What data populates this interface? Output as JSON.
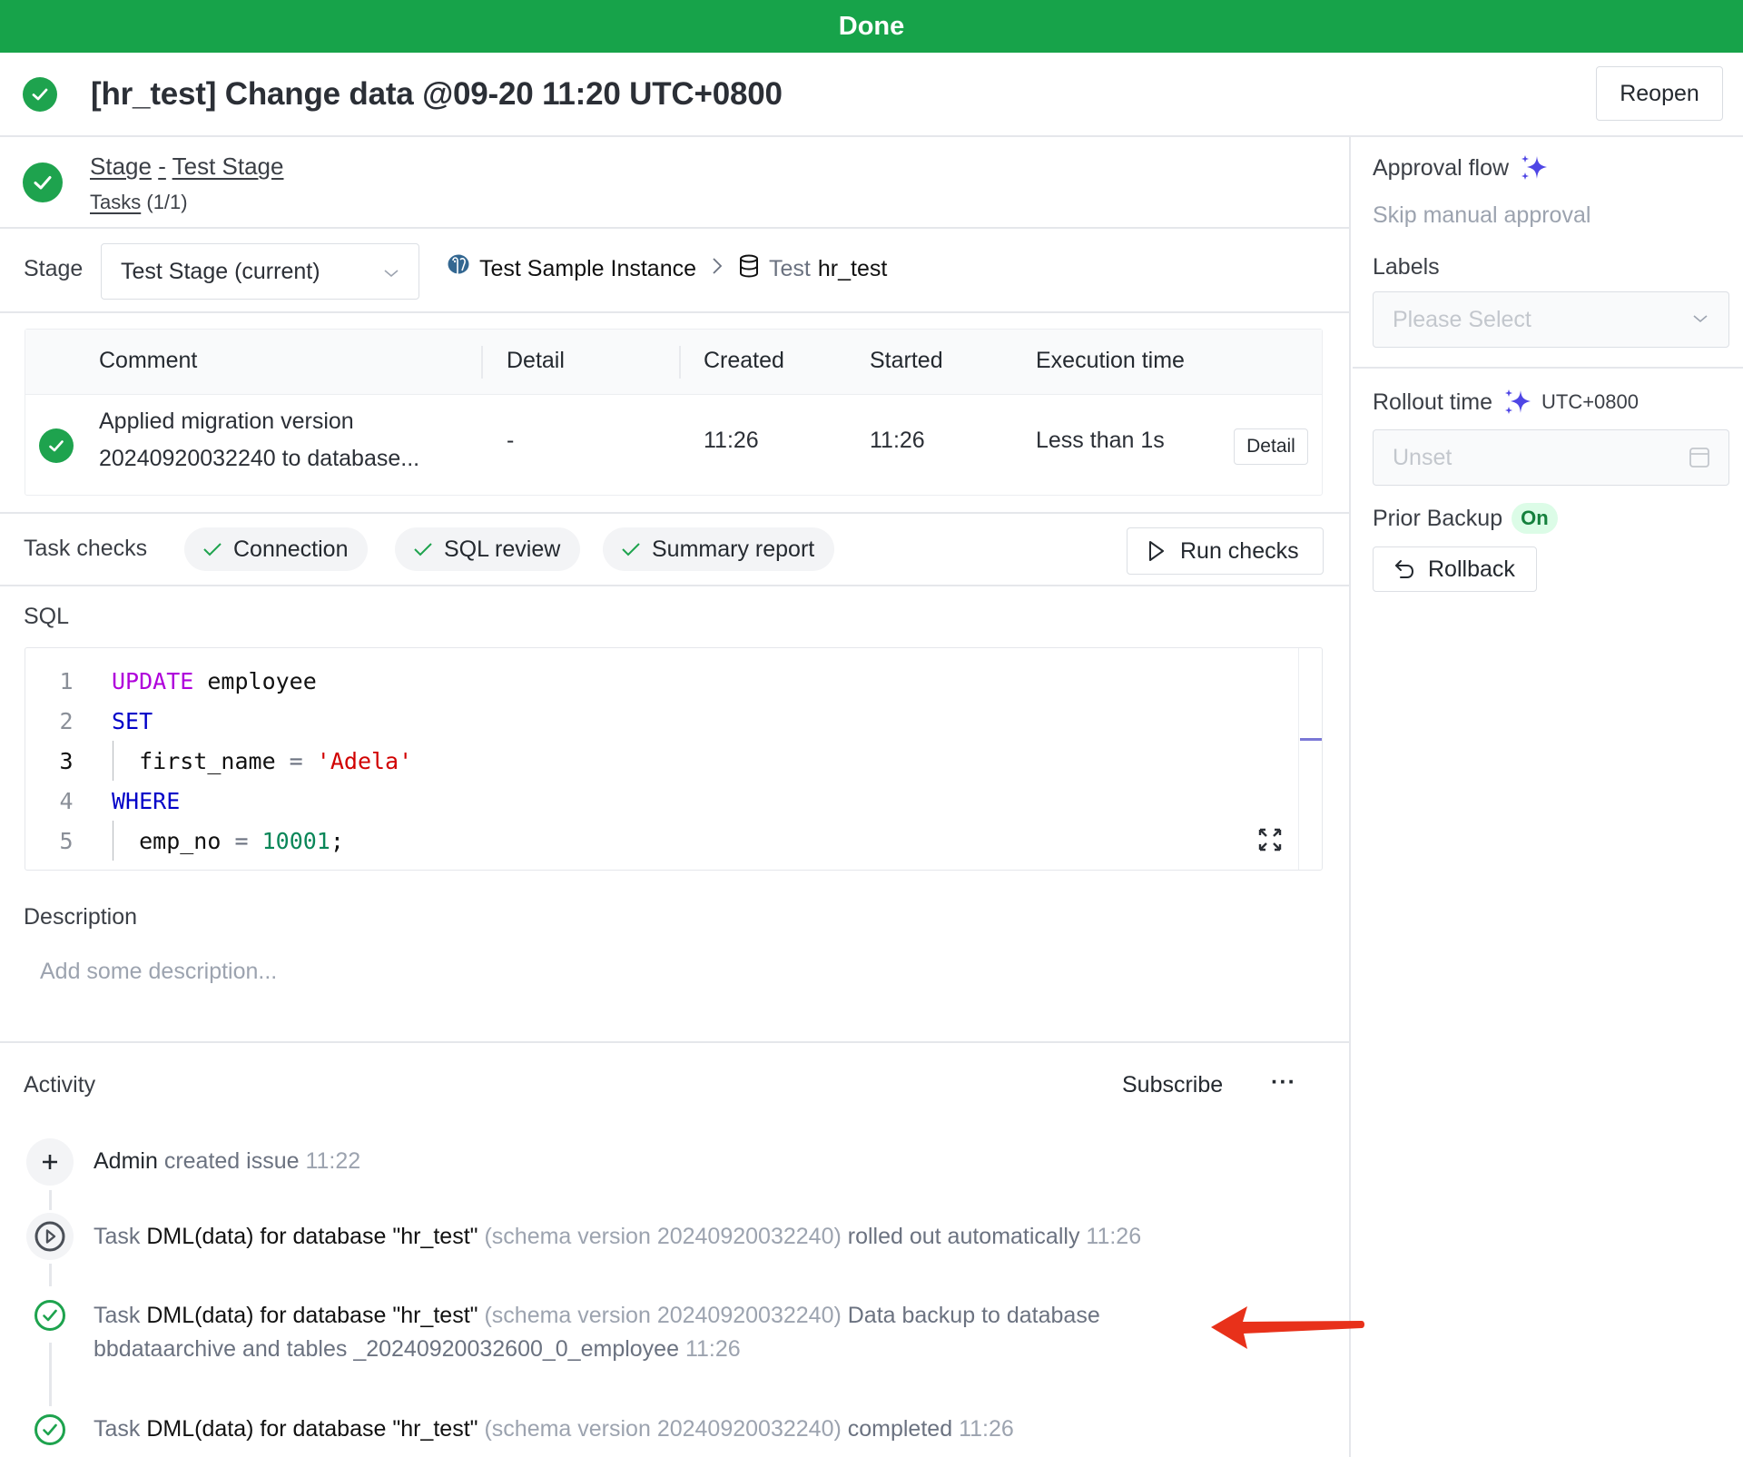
{
  "status_bar": {
    "label": "Done",
    "color": "#17a34a"
  },
  "header": {
    "title": "[hr_test] Change data @09-20 11:20 UTC+0800",
    "status_icon": "check-circle-icon",
    "reopen_label": "Reopen"
  },
  "stage": {
    "link_stage": "Stage",
    "link_sep": "-",
    "link_name": "Test Stage",
    "tasks_label": "Tasks",
    "tasks_count": "(1/1)",
    "selector_label": "Stage",
    "selector_value": "Test Stage (current)",
    "instance_name": "Test Sample Instance",
    "instance_icon": "postgresql-elephant-icon",
    "database_env": "Test",
    "database_name": "hr_test",
    "database_icon": "database-icon"
  },
  "task_table": {
    "columns": [
      "Comment",
      "Detail",
      "Created",
      "Started",
      "Execution time"
    ],
    "rows": [
      {
        "status": "done",
        "comment_line1": "Applied migration version",
        "comment_line2": "20240920032240 to database...",
        "detail": "-",
        "created": "11:26",
        "started": "11:26",
        "execution_time": "Less than 1s",
        "detail_button": "Detail"
      }
    ]
  },
  "task_checks": {
    "label": "Task checks",
    "chips": [
      {
        "label": "Connection",
        "status": "success"
      },
      {
        "label": "SQL review",
        "status": "success"
      },
      {
        "label": "Summary report",
        "status": "success"
      }
    ],
    "run_checks_label": "Run checks"
  },
  "sql": {
    "label": "SQL",
    "lines": [
      {
        "n": "1",
        "tokens": [
          {
            "t": "UPDATE",
            "c": "kw-purple"
          },
          {
            "t": " employee",
            "c": ""
          }
        ]
      },
      {
        "n": "2",
        "tokens": [
          {
            "t": "SET",
            "c": "kw-blue"
          }
        ]
      },
      {
        "n": "3",
        "tokens": [
          {
            "t": "  first_name ",
            "c": ""
          },
          {
            "t": "=",
            "c": "op"
          },
          {
            "t": " ",
            "c": ""
          },
          {
            "t": "'Adela'",
            "c": "str"
          }
        ]
      },
      {
        "n": "4",
        "tokens": [
          {
            "t": "WHERE",
            "c": "kw-blue"
          }
        ]
      },
      {
        "n": "5",
        "tokens": [
          {
            "t": "  emp_no ",
            "c": ""
          },
          {
            "t": "=",
            "c": "op"
          },
          {
            "t": " ",
            "c": ""
          },
          {
            "t": "10001",
            "c": "num"
          },
          {
            "t": ";",
            "c": ""
          }
        ]
      }
    ],
    "active_line": "3"
  },
  "description": {
    "label": "Description",
    "placeholder": "Add some description..."
  },
  "activity": {
    "label": "Activity",
    "subscribe_label": "Subscribe",
    "more_label": "···",
    "items": [
      {
        "icon": "plus-icon",
        "actor": "Admin",
        "action": "created issue",
        "time": "11:22"
      },
      {
        "icon": "play-circle-icon",
        "prefix": "Task",
        "task": "DML(data) for database \"hr_test\"",
        "schema": "(schema version 20240920032240)",
        "action": "rolled out automatically",
        "time": "11:26"
      },
      {
        "icon": "check-circle-outline-icon",
        "prefix": "Task",
        "task": "DML(data) for database \"hr_test\"",
        "schema": "(schema version 20240920032240)",
        "action": "Data backup to database",
        "action_line2": "bbdataarchive and tables _20240920032600_0_employee",
        "time": "11:26"
      },
      {
        "icon": "check-circle-outline-icon",
        "prefix": "Task",
        "task": "DML(data) for database \"hr_test\"",
        "schema": "(schema version 20240920032240)",
        "action": "completed",
        "time": "11:26"
      }
    ]
  },
  "sidebar": {
    "approval_flow_label": "Approval flow",
    "approval_flow_value": "Skip manual approval",
    "labels_label": "Labels",
    "labels_placeholder": "Please Select",
    "rollout_time_label": "Rollout time",
    "rollout_timezone": "UTC+0800",
    "rollout_time_value": "Unset",
    "prior_backup_label": "Prior Backup",
    "prior_backup_status": "On",
    "rollback_label": "Rollback",
    "accent_color": "#4f46e5"
  },
  "annotation": {
    "type": "red-arrow",
    "color": "#e8311a"
  }
}
